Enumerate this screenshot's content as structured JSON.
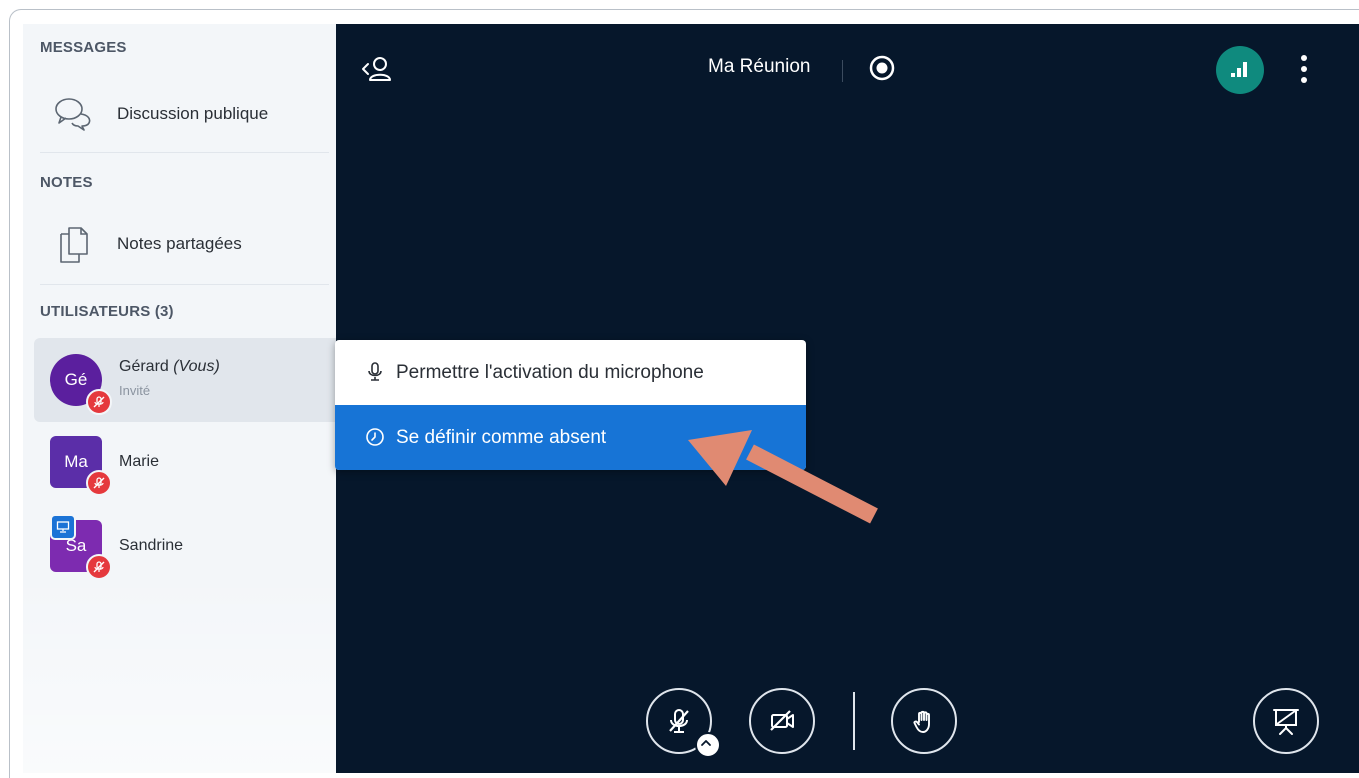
{
  "sidebar": {
    "messages_title": "MESSAGES",
    "public_chat_label": "Discussion publique",
    "notes_title": "NOTES",
    "shared_notes_label": "Notes partagées",
    "users_title": "UTILISATEURS (3)",
    "users": [
      {
        "initials": "Gé",
        "name": "Gérard",
        "suffix": "(Vous)",
        "role": "Invité",
        "color": "#5b1f9e",
        "shape": "round",
        "muted": true
      },
      {
        "initials": "Ma",
        "name": "Marie",
        "color": "#5b2ea8",
        "shape": "square",
        "muted": true
      },
      {
        "initials": "Sa",
        "name": "Sandrine",
        "color": "#7d2bb0",
        "shape": "square",
        "muted": true,
        "presenter": true
      }
    ]
  },
  "header": {
    "meeting_title": "Ma Réunion"
  },
  "menu": {
    "items": [
      {
        "label": "Permettre l'activation du microphone",
        "icon": "microphone-icon"
      },
      {
        "label": "Se définir comme absent",
        "icon": "clock-icon",
        "selected": true
      }
    ]
  },
  "colors": {
    "main_bg": "#06172b",
    "sidebar_bg": "#f3f6f9",
    "selected_menu": "#1774d6",
    "connection": "#0f8a7e",
    "muted_badge": "#e5393d",
    "annotation_arrow": "#e08a72"
  }
}
